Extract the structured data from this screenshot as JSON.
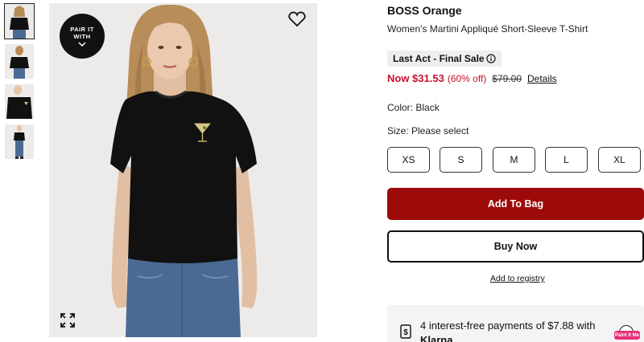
{
  "gallery": {
    "pair_badge": "PAIR IT WITH",
    "thumbnails": [
      "front view",
      "back view",
      "detail view",
      "full view"
    ]
  },
  "product": {
    "brand": "BOSS Orange",
    "name": "Women's Martini Appliqué Short-Sleeve T-Shirt",
    "sale_badge": "Last Act - Final Sale",
    "price_now": "Now $31.53",
    "price_off": "(60% off)",
    "price_was": "$79.00",
    "details_link": "Details",
    "color_label": "Color: Black",
    "size_label": "Size: Please select",
    "sizes": [
      "XS",
      "S",
      "M",
      "L",
      "XL"
    ]
  },
  "actions": {
    "add_to_bag": "Add To Bag",
    "buy_now": "Buy Now",
    "add_to_registry": "Add to registry"
  },
  "klarna": {
    "text": "4 interest-free payments of $7.88 with",
    "brand": "Klarna"
  },
  "extension_badge": "Paint it Me",
  "colors": {
    "sale_red": "#c8102e",
    "add_to_bag_bg": "#9c0a0a",
    "shirt": "#111111",
    "jeans": "#4a6a93"
  },
  "icons": [
    "heart-icon",
    "expand-icon",
    "chevron-down-icon",
    "info-icon",
    "klarna-dollar-icon"
  ]
}
